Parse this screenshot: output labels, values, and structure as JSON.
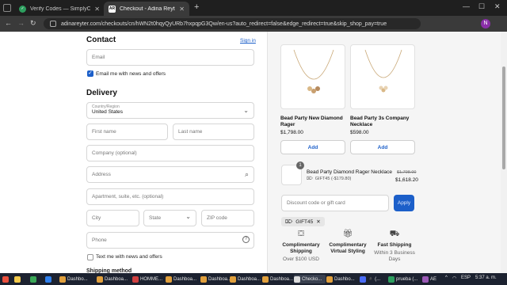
{
  "browser": {
    "tabs": [
      {
        "title": "Verify Codes — SimplyCodes",
        "active": false
      },
      {
        "title": "Checkout - Adina Reyter",
        "active": true
      }
    ],
    "url": "adinareyter.com/checkouts/cn/hWN2t0hqyQyURb7hxpqpG3Qw/en-us?auto_redirect=false&edge_redirect=true&skip_shop_pay=true",
    "profile_initial": "N",
    "accent_color": "#8a2fa8"
  },
  "contact": {
    "heading": "Contact",
    "sign_in": "Sign in",
    "email_placeholder": "Email",
    "news_offers_label": "Email me with news and offers"
  },
  "delivery": {
    "heading": "Delivery",
    "country_label": "Country/Region",
    "country_value": "United States",
    "first_name": "First name",
    "last_name": "Last name",
    "company": "Company (optional)",
    "address": "Address",
    "apartment": "Apartment, suite, etc. (optional)",
    "city": "City",
    "state": "State",
    "zip": "ZIP code",
    "phone": "Phone",
    "text_offers_label": "Text me with news and offers",
    "shipping_method": "Shipping method"
  },
  "upsell_products": [
    {
      "name": "Bead Party New Diamond Rager",
      "price": "$1,798.00",
      "button": "Add"
    },
    {
      "name": "Bead Party 3s Company Necklace",
      "price": "$598.00",
      "button": "Add"
    }
  ],
  "cart_line": {
    "quantity": "1",
    "name": "Bead Party Diamond Rager Necklace",
    "discount": "GIFT45 (-$179.80)",
    "original_price": "$1,798.00",
    "price": "$1,618.20"
  },
  "discount": {
    "placeholder": "Discount code or gift card",
    "apply": "Apply",
    "applied_code": "GIFT45"
  },
  "features": [
    {
      "title": "Complimentary Shipping",
      "subtitle": "Over $100 USD",
      "icon": "gift-box-icon"
    },
    {
      "title": "Complimentary Virtual Styling",
      "subtitle": "",
      "icon": "present-icon"
    },
    {
      "title": "Fast Shipping",
      "subtitle": "Within 3 Business Days",
      "icon": "truck-icon"
    }
  ],
  "taskbar": {
    "items": [
      "Dashbo...",
      "Dashboa...",
      "HOMME...",
      "Dashboa...",
      "Dashboa...",
      "Dashboa...",
      "Dashboa...",
      "Checko...",
      "Dashbo...",
      "#️ (...",
      "prueba (...",
      "AE"
    ],
    "language": "ESP",
    "time": "5:37 a. m."
  }
}
